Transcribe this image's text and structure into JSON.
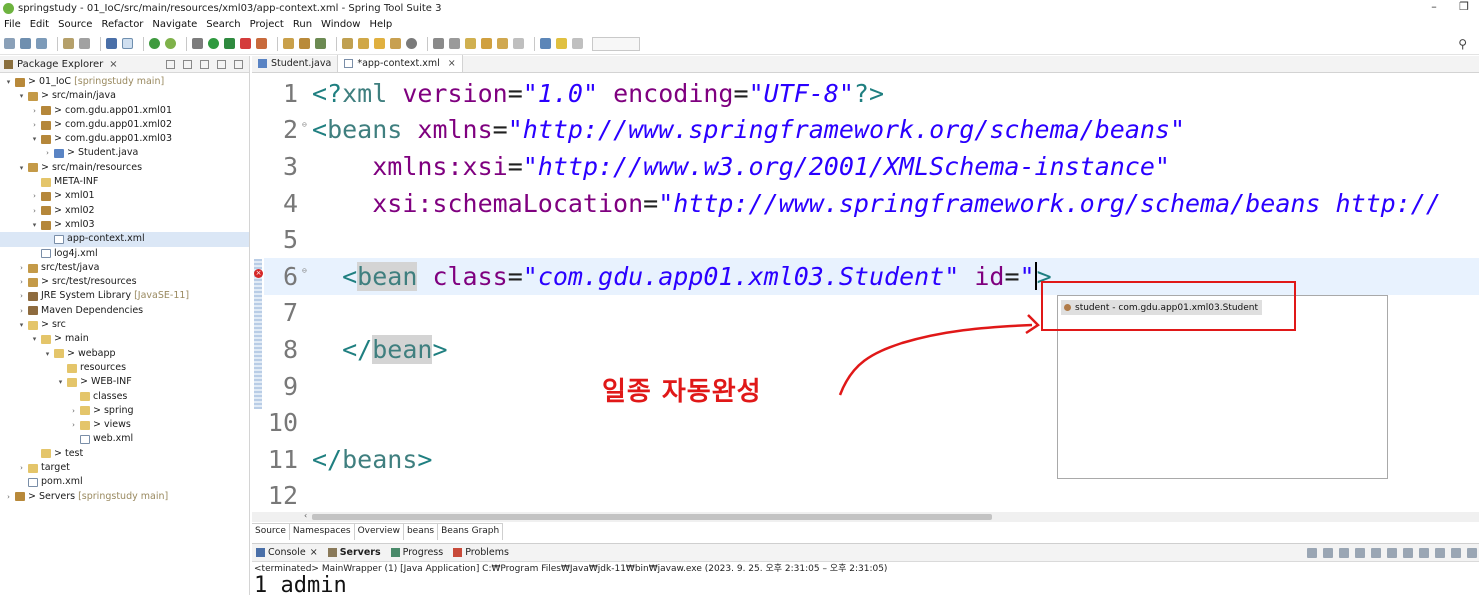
{
  "window": {
    "title": "springstudy - 01_IoC/src/main/resources/xml03/app-context.xml - Spring Tool Suite 3",
    "minimize": "–",
    "restore": "❐"
  },
  "menu": [
    "File",
    "Edit",
    "Source",
    "Refactor",
    "Navigate",
    "Search",
    "Project",
    "Run",
    "Window",
    "Help"
  ],
  "toolbar": {
    "search_icon": "search-icon"
  },
  "package_explorer": {
    "tab_label": "Package Explorer",
    "tree": [
      {
        "indent": 0,
        "twisty": "▾",
        "icon": "ic-proj",
        "label": "> 01_IoC",
        "extra": "[springstudy main]"
      },
      {
        "indent": 1,
        "twisty": "▾",
        "icon": "ic-src",
        "label": "> src/main/java",
        "extra": ""
      },
      {
        "indent": 2,
        "twisty": "›",
        "icon": "ic-pkg",
        "label": "> com.gdu.app01.xml01",
        "extra": ""
      },
      {
        "indent": 2,
        "twisty": "›",
        "icon": "ic-pkg",
        "label": "> com.gdu.app01.xml02",
        "extra": ""
      },
      {
        "indent": 2,
        "twisty": "▾",
        "icon": "ic-pkg",
        "label": "> com.gdu.app01.xml03",
        "extra": ""
      },
      {
        "indent": 3,
        "twisty": "›",
        "icon": "ic-java",
        "label": "> Student.java",
        "extra": ""
      },
      {
        "indent": 1,
        "twisty": "▾",
        "icon": "ic-src",
        "label": "> src/main/resources",
        "extra": ""
      },
      {
        "indent": 2,
        "twisty": "",
        "icon": "ic-folder",
        "label": "META-INF",
        "extra": ""
      },
      {
        "indent": 2,
        "twisty": "›",
        "icon": "ic-pkg",
        "label": "> xml01",
        "extra": ""
      },
      {
        "indent": 2,
        "twisty": "›",
        "icon": "ic-pkg",
        "label": "> xml02",
        "extra": ""
      },
      {
        "indent": 2,
        "twisty": "▾",
        "icon": "ic-pkg",
        "label": "> xml03",
        "extra": ""
      },
      {
        "indent": 3,
        "twisty": "",
        "icon": "ic-file",
        "label": "app-context.xml",
        "extra": "",
        "selected": true
      },
      {
        "indent": 2,
        "twisty": "",
        "icon": "ic-file",
        "label": "log4j.xml",
        "extra": ""
      },
      {
        "indent": 1,
        "twisty": "›",
        "icon": "ic-src",
        "label": "src/test/java",
        "extra": ""
      },
      {
        "indent": 1,
        "twisty": "›",
        "icon": "ic-src",
        "label": "> src/test/resources",
        "extra": ""
      },
      {
        "indent": 1,
        "twisty": "›",
        "icon": "ic-lib",
        "label": "JRE System Library",
        "extra": "[JavaSE-11]"
      },
      {
        "indent": 1,
        "twisty": "›",
        "icon": "ic-lib",
        "label": "Maven Dependencies",
        "extra": ""
      },
      {
        "indent": 1,
        "twisty": "▾",
        "icon": "ic-folder",
        "label": "> src",
        "extra": ""
      },
      {
        "indent": 2,
        "twisty": "▾",
        "icon": "ic-folder",
        "label": "> main",
        "extra": ""
      },
      {
        "indent": 3,
        "twisty": "▾",
        "icon": "ic-folder",
        "label": "> webapp",
        "extra": ""
      },
      {
        "indent": 4,
        "twisty": "",
        "icon": "ic-folder",
        "label": "resources",
        "extra": ""
      },
      {
        "indent": 4,
        "twisty": "▾",
        "icon": "ic-folder",
        "label": "> WEB-INF",
        "extra": ""
      },
      {
        "indent": 5,
        "twisty": "",
        "icon": "ic-folder",
        "label": "classes",
        "extra": ""
      },
      {
        "indent": 5,
        "twisty": "›",
        "icon": "ic-folder",
        "label": "> spring",
        "extra": ""
      },
      {
        "indent": 5,
        "twisty": "›",
        "icon": "ic-folder",
        "label": "> views",
        "extra": ""
      },
      {
        "indent": 5,
        "twisty": "",
        "icon": "ic-file",
        "label": "web.xml",
        "extra": ""
      },
      {
        "indent": 2,
        "twisty": "",
        "icon": "ic-folder",
        "label": "> test",
        "extra": ""
      },
      {
        "indent": 1,
        "twisty": "›",
        "icon": "ic-folder",
        "label": "target",
        "extra": ""
      },
      {
        "indent": 1,
        "twisty": "",
        "icon": "ic-file",
        "label": "pom.xml",
        "extra": ""
      },
      {
        "indent": 0,
        "twisty": "›",
        "icon": "ic-proj",
        "label": "> Servers",
        "extra": "[springstudy main]"
      }
    ]
  },
  "editor": {
    "tabs": [
      {
        "label": "Student.java",
        "active": false,
        "close": ""
      },
      {
        "label": "*app-context.xml",
        "active": true,
        "close": "×"
      }
    ],
    "line_numbers": [
      "1",
      "2",
      "3",
      "4",
      "5",
      "6",
      "7",
      "8",
      "9",
      "10",
      "11",
      "12"
    ],
    "code": {
      "l1_open": "<?",
      "l1_xml": "xml",
      "l1_version_attr": "version",
      "l1_version_val": "\"1.0\"",
      "l1_encoding_attr": "encoding",
      "l1_encoding_val": "\"UTF-8\"",
      "l1_close": "?>",
      "l2_beans": "beans",
      "l2_xmlns": "xmlns",
      "l2_xmlns_val": "\"http://www.springframework.org/schema/beans\"",
      "l3_attr": "xmlns:xsi",
      "l3_val": "\"http://www.w3.org/2001/XMLSchema-instance\"",
      "l4_attr": "xsi:schemaLocation",
      "l4_val": "\"http://www.springframework.org/schema/beans http://",
      "l6_bean": "bean",
      "l6_class": "class",
      "l6_class_val": "\"com.gdu.app01.xml03.Student\"",
      "l6_id": "id",
      "l6_quote": "\"",
      "l8_bean": "bean",
      "l11_beans": "beans"
    },
    "autocomplete": {
      "item": "student - com.gdu.app01.xml03.Student"
    },
    "annotation": "일종 자동완성",
    "bottom_tabs": [
      "Source",
      "Namespaces",
      "Overview",
      "beans",
      "Beans Graph"
    ]
  },
  "console": {
    "tabs": [
      {
        "label": "Console",
        "close": "×",
        "active": false
      },
      {
        "label": "Servers",
        "close": "",
        "active": true
      },
      {
        "label": "Progress",
        "close": "",
        "active": false
      },
      {
        "label": "Problems",
        "close": "",
        "active": false
      }
    ],
    "status": "<terminated> MainWrapper (1) [Java Application] C:₩Program Files₩Java₩jdk-11₩bin₩javaw.exe  (2023. 9. 25. 오후 2:31:05 – 오후 2:31:05)",
    "output": "1  admin"
  }
}
